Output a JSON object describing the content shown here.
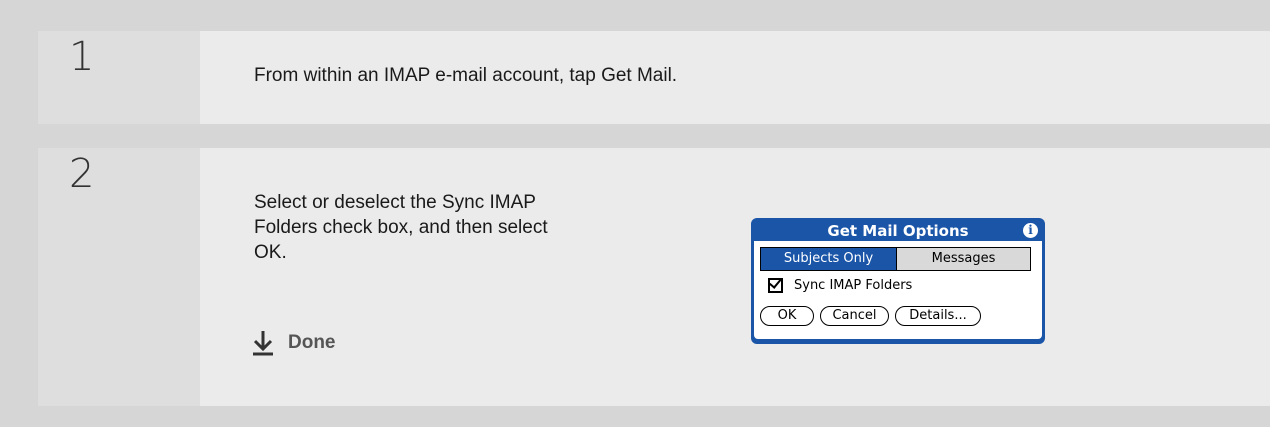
{
  "steps": [
    {
      "number": "1",
      "text": "From within an IMAP e-mail account, tap Get Mail."
    },
    {
      "number": "2",
      "text": "Select or deselect the Sync IMAP Folders check box, and then select OK."
    }
  ],
  "done_label": "Done",
  "dialog": {
    "title": "Get Mail Options",
    "info_icon": "i",
    "tabs": [
      "Subjects Only",
      "Messages"
    ],
    "selected_tab": "Subjects Only",
    "checkbox_label": "Sync IMAP Folders",
    "checkbox_checked": true,
    "buttons": {
      "ok": "OK",
      "cancel": "Cancel",
      "details": "Details..."
    }
  },
  "colors": {
    "dialog_blue": "#1a55a8",
    "page_bg": "#d6d6d6"
  }
}
